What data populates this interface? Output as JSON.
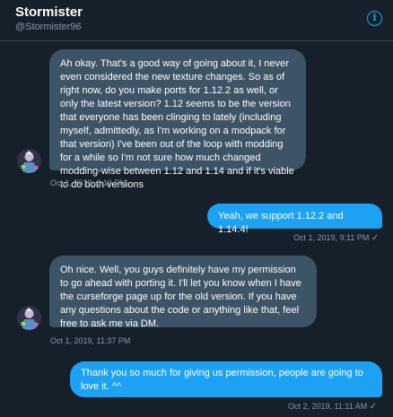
{
  "header": {
    "name": "Stormister",
    "handle": "@Stormister96",
    "info_glyph": "i"
  },
  "messages": [
    {
      "direction": "received",
      "text": "Ah okay. That's a good way of going about it, I never even considered the new texture changes. So as of right now, do you make ports for 1.12.2 as well, or only the latest version? 1.12 seems to be the version that everyone has been clinging to lately (including myself, admittedly, as I'm working on a modpack for that version) I've been out of the loop with modding for a while so I'm not sure how much changed modding-wise between 1.12 and 1.14 and if it's viable to do both versions",
      "timestamp": "Oct 1, 2019, 6:19 PM"
    },
    {
      "direction": "sent",
      "text": "Yeah, we support 1.12.2 and 1.14.4!",
      "timestamp": "Oct 1, 2019, 9:11 PM"
    },
    {
      "direction": "received",
      "text": "Oh nice. Well, you guys definitely have my permission to go ahead with porting it. I'll let you know when I have the curseforge page up for the old version. If you have any questions about the code or anything like that, feel free to ask me via DM.",
      "timestamp": "Oct 1, 2019, 11:37 PM"
    },
    {
      "direction": "sent",
      "text": "Thank you so much for giving us permission, people are going to love it. ^^",
      "timestamp": "Oct 2, 2019, 11:11 AM"
    }
  ],
  "read_check": "✓",
  "colors": {
    "background": "#15202b",
    "received_bubble": "#3d5466",
    "sent_bubble": "#1da1f2",
    "muted_text": "#8899a6"
  },
  "icons": {
    "info": "info-circle-icon",
    "read": "checkmark-icon"
  }
}
